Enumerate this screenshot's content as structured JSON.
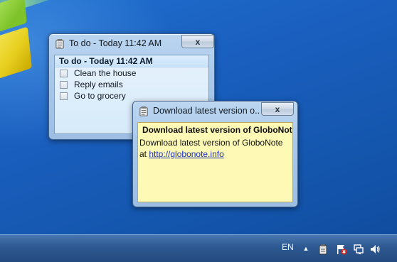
{
  "todo_window": {
    "title": "To do - Today 11:42 AM",
    "close_label": "x",
    "header": "To do - Today 11:42 AM",
    "items": [
      {
        "label": "Clean the house",
        "checked": false
      },
      {
        "label": "Reply emails",
        "checked": false
      },
      {
        "label": "Go to grocery",
        "checked": false
      }
    ]
  },
  "note_window": {
    "title": "Download latest version o...",
    "close_label": "x",
    "header": "Download latest version of GloboNote...",
    "body_line1": "Download latest version of GloboNote",
    "body_prefix": "at ",
    "link": "http://globonote.info",
    "background": "#fef9b5"
  },
  "taskbar": {
    "language": "EN",
    "tray_icons": [
      "show-hidden-icons-chevron",
      "globonote-tray-icon",
      "action-center-flag-icon",
      "network-icon",
      "volume-icon"
    ]
  },
  "colors": {
    "desktop": "#1a5fbf",
    "link": "#1b2fb8"
  }
}
